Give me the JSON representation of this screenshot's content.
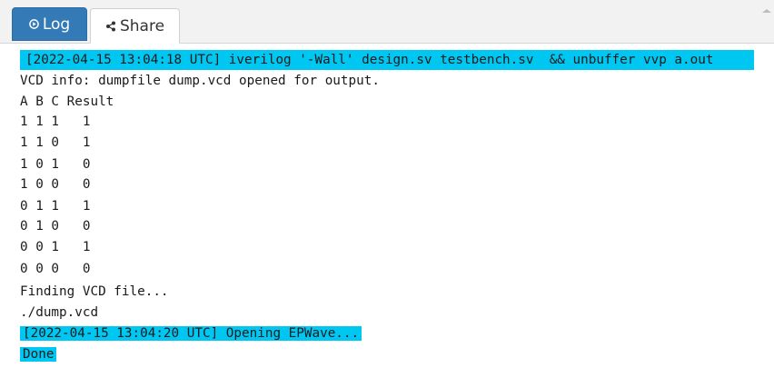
{
  "tabs": {
    "log_label": "Log",
    "share_label": "Share"
  },
  "colors": {
    "highlight": "#00c7f2",
    "active_tab": "#337ab7"
  },
  "icons": {
    "log": "play-circle-icon",
    "share": "share-icon"
  },
  "log": {
    "cmd_line": "[2022-04-15 13:04:18 UTC] iverilog '-Wall' design.sv testbench.sv  && unbuffer vvp a.out",
    "vcd_info": "VCD info: dumpfile dump.vcd opened for output.",
    "header": "A B C Result",
    "rows": [
      "1 1 1   1",
      "1 1 0   1",
      "1 0 1   0",
      "1 0 0   0",
      "0 1 1   1",
      "0 1 0   0",
      "0 0 1   1",
      "0 0 0   0"
    ],
    "finding": "Finding VCD file...",
    "path": "./dump.vcd",
    "opening": "[2022-04-15 13:04:20 UTC] Opening EPWave...",
    "done": "Done"
  }
}
